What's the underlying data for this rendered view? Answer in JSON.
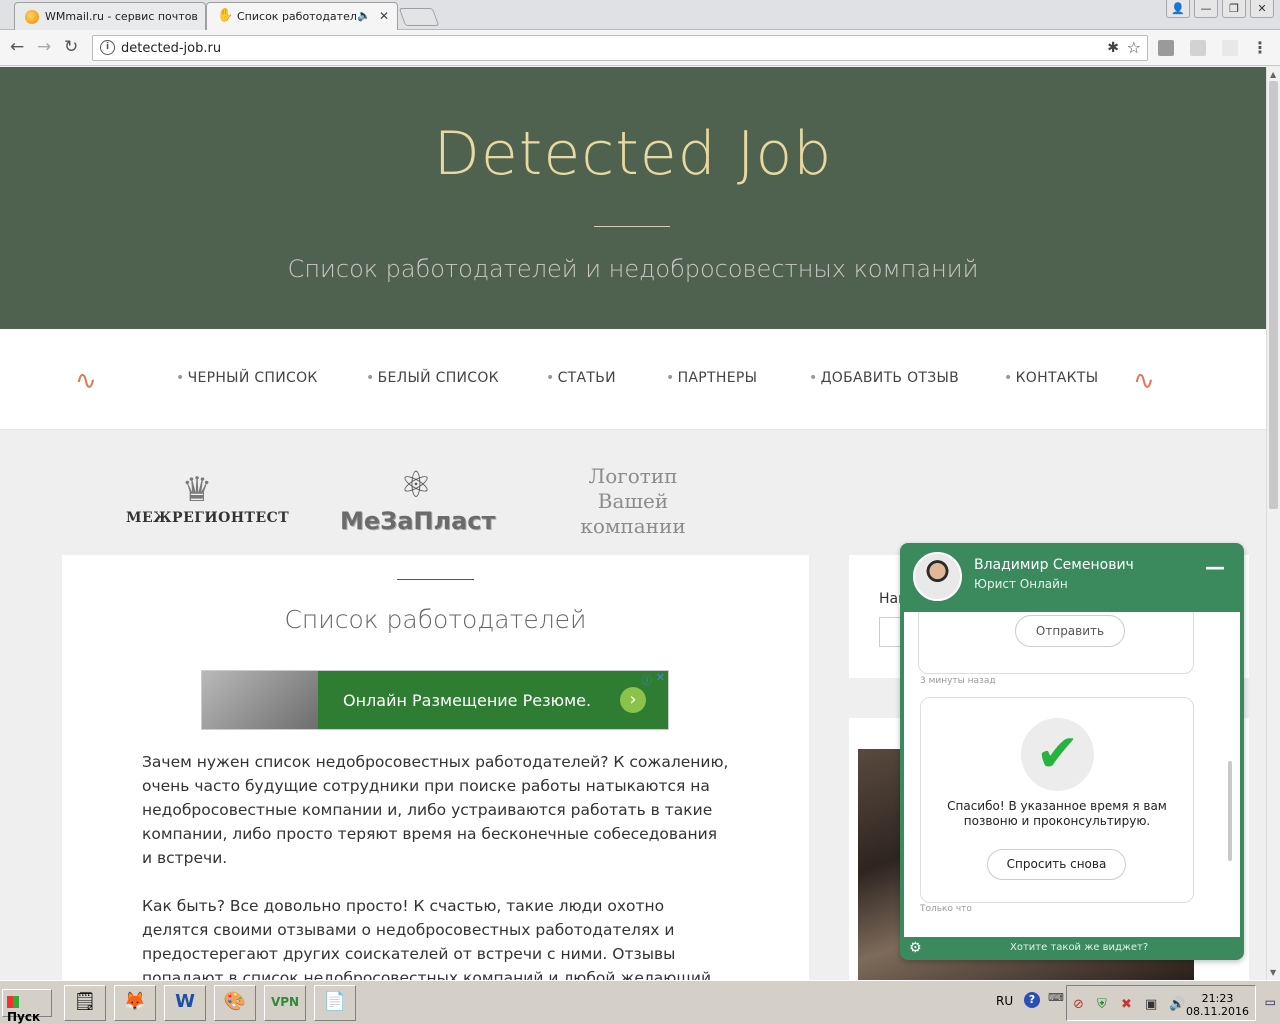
{
  "browser": {
    "tabs": [
      {
        "title": "WMmail.ru - сервис почтов",
        "active": false
      },
      {
        "title": "Список работодател",
        "active": true
      }
    ],
    "url": "detected-job.ru"
  },
  "site": {
    "title": "Detected Job",
    "subtitle": "Список работодателей и недобросовестных компаний",
    "nav": [
      "ЧЕРНЫЙ СПИСОК",
      "БЕЛЫЙ СПИСОК",
      "СТАТЬИ",
      "ПАРТНЕРЫ",
      "ДОБАВИТЬ ОТЗЫВ",
      "КОНТАКТЫ"
    ],
    "logos": {
      "partner1": "МЕЖРЕГИОНТЕСТ",
      "partner2": "МеЗаПласт",
      "placeholder": "Логотип Вашей компании"
    }
  },
  "content": {
    "heading": "Список работодателей",
    "ad_text": "Онлайн Размещение Резюме.",
    "paragraph1": "Зачем нужен список недобросовестных работодателей? К сожалению, очень часто будущие сотрудники при поиске работы натыкаются на недобросовестные компании и, либо устраиваются работать в такие компании, либо просто теряют время на бесконечные собеседования и встречи.",
    "paragraph2": "Как быть? Все довольно просто! К счастью, такие люди охотно делятся своими отзывами о недобросовестных работодателях и предостерегают других соискателей от встречи с ними. Отзывы попадают в список недобросовестных компаний и любой желающий может ознакомиться с"
  },
  "sidebar": {
    "search_label": "Най"
  },
  "chat": {
    "agent_name": "Владимир Семенович",
    "agent_role": "Юрист Онлайн",
    "send_button": "Отправить",
    "time_ago": "3 минуты назад",
    "thanks_message": "Спасибо! В указанное время я вам позвоню и проконсультирую.",
    "ask_again_button": "Спросить снова",
    "time_now": "Только что",
    "promo": "Хотите такой же виджет?"
  },
  "taskbar": {
    "start_label": "Пуск",
    "language": "RU",
    "time": "21:23",
    "date": "08.11.2016"
  }
}
